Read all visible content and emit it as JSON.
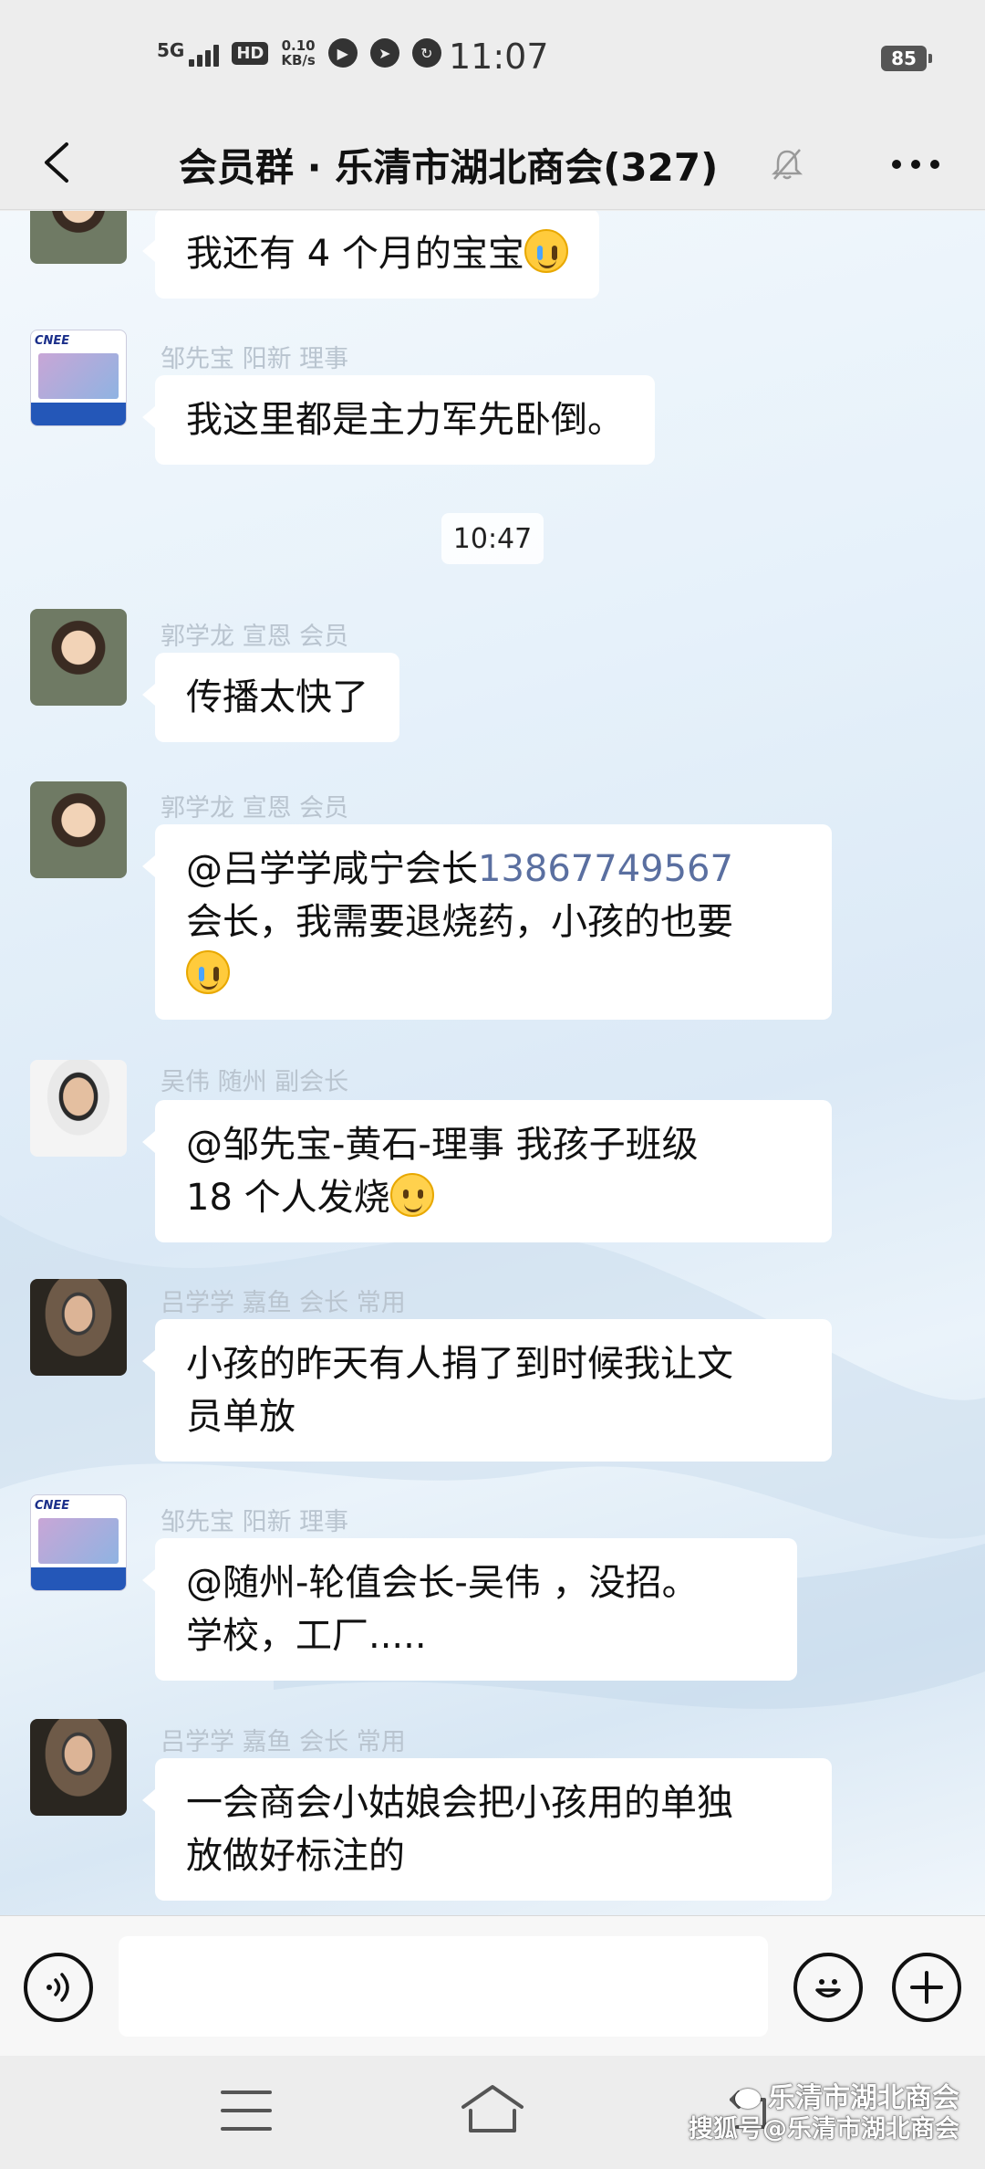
{
  "status_bar": {
    "network": "5G",
    "hd": "HD",
    "speed_value": "0.10",
    "speed_unit": "KB/s",
    "time": "11:07",
    "battery": "85"
  },
  "header": {
    "title": "会员群 · 乐清市湖北商会(327)"
  },
  "chat": {
    "timestamp": "10:47",
    "messages": [
      {
        "sender": "",
        "lines": [
          "我还有 4 个月的宝宝"
        ]
      },
      {
        "sender": "邹先宝  阳新  理事",
        "lines": [
          "我这里都是主力军先卧倒。"
        ]
      },
      {
        "sender": "郭学龙 宣恩 会员",
        "lines": [
          "传播太快了"
        ]
      },
      {
        "sender": "郭学龙 宣恩 会员",
        "mention": "@吕学学咸宁会长",
        "phone": "13867749567",
        "lines": [
          "会长，我需要退烧药，小孩的也要"
        ]
      },
      {
        "sender": "吴伟  随州  副会长",
        "lines": [
          "@邹先宝-黄石-理事  我孩子班级",
          "18 个人发烧"
        ]
      },
      {
        "sender": "吕学学 嘉鱼 会长 常用",
        "lines": [
          "小孩的昨天有人捐了到时候我让文",
          "员单放"
        ]
      },
      {
        "sender": "邹先宝  阳新  理事",
        "lines": [
          "@随州-轮值会长-吴伟 ，没招。",
          "学校，工厂....."
        ]
      },
      {
        "sender": "吕学学 嘉鱼 会长 常用",
        "lines": [
          "一会商会小姑娘会把小孩用的单独",
          "放做好标注的"
        ]
      }
    ],
    "avatar_logo_text": "CNEE"
  },
  "watermark": {
    "line1": "乐清市湖北商会",
    "line2": "搜狐号@乐清市湖北商会"
  },
  "icons": {
    "back": "back-arrow-icon",
    "mute": "mute-bell-icon",
    "more": "more-dots-icon",
    "voice": "voice-icon",
    "emoji": "emoji-icon",
    "plus": "plus-icon",
    "nav_menu": "menu-icon",
    "nav_home": "home-icon",
    "nav_back": "back-icon"
  },
  "colors": {
    "header_bg": "#ededed",
    "bubble_bg": "#ffffff",
    "sender_name": "#b9c4cf",
    "link": "#5a6fa0"
  }
}
